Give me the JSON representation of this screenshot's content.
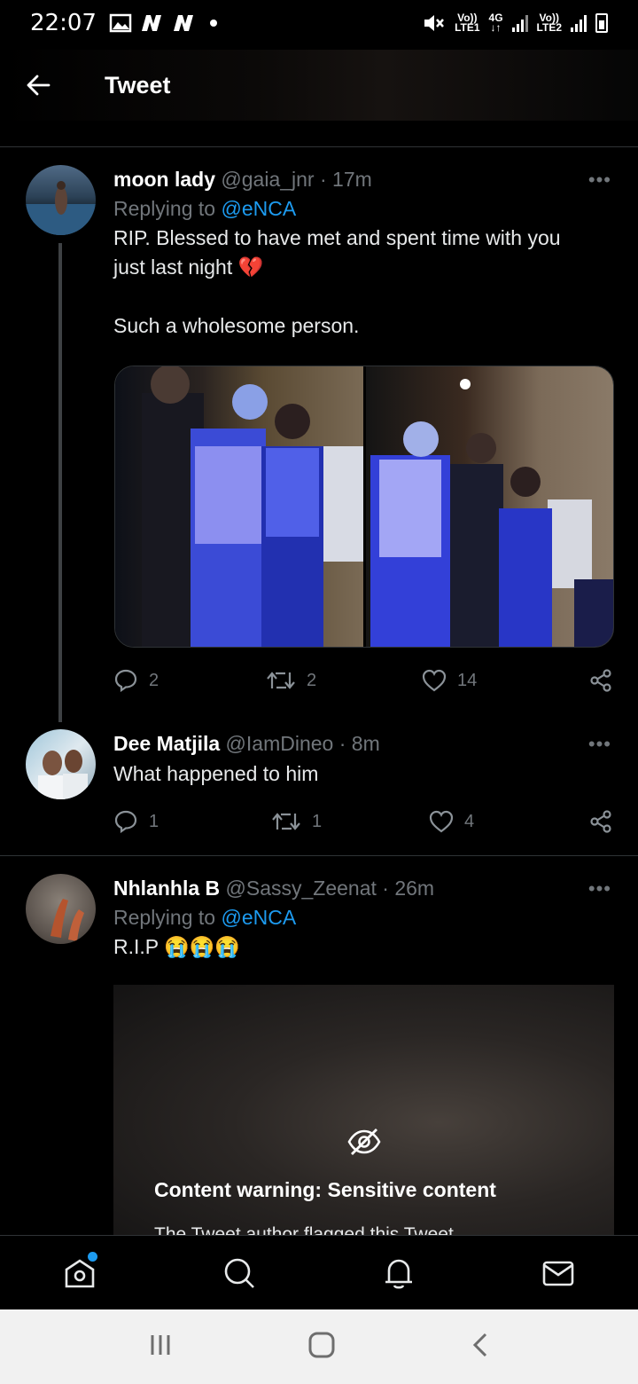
{
  "status_bar": {
    "time": "22:07",
    "sim1_label_top": "Vo))",
    "sim1_label_bottom": "LTE1",
    "network_type": "4G",
    "sim2_label_top": "Vo))",
    "sim2_label_bottom": "LTE2"
  },
  "header": {
    "title": "Tweet"
  },
  "tweets": [
    {
      "name": "moon lady",
      "handle": "@gaia_jnr",
      "time": "· 17m",
      "replying_prefix": "Replying to ",
      "replying_to": "@eNCA",
      "text_line1": "RIP. Blessed to have met and spent time with you",
      "text_line2": "just last night 💔",
      "text_line3": "Such a wholesome person.",
      "replies": "2",
      "retweets": "2",
      "likes": "14"
    },
    {
      "name": "Dee Matjila",
      "handle": "@IamDineo",
      "time": "· 8m",
      "text_line1": "What happened to him",
      "replies": "1",
      "retweets": "1",
      "likes": "4"
    },
    {
      "name": "Nhlanhla B",
      "handle": "@Sassy_Zeenat",
      "time": "· 26m",
      "replying_prefix": "Replying to ",
      "replying_to": "@eNCA",
      "text_line1": "R.I.P 😭😭😭",
      "warning_title": "Content warning: Sensitive content",
      "warning_sub": "The Tweet author flagged this Tweet"
    }
  ],
  "more_label": "•••",
  "bottom_nav": [
    "home",
    "search",
    "notifications",
    "messages"
  ],
  "colors": {
    "accent": "#1d9bf0",
    "background": "#000000",
    "muted": "#71767b"
  }
}
